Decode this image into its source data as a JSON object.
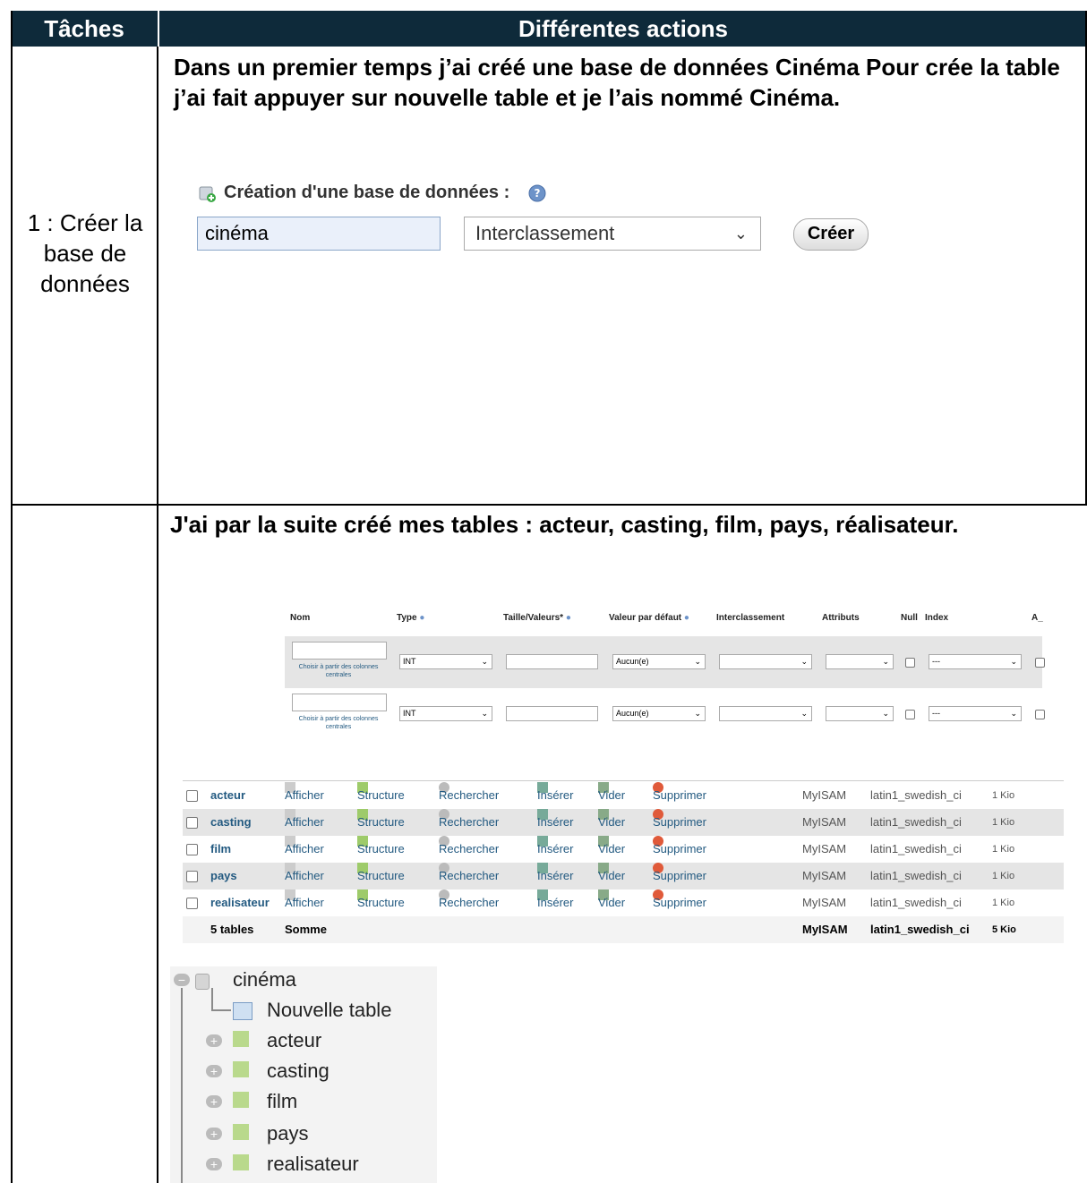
{
  "header": {
    "col1": "Tâches",
    "col2": "Différentes actions"
  },
  "task1": {
    "label": "1 : Créer la base de données",
    "text": "Dans un premier temps j’ai créé une base de données Cinéma Pour crée la table j’ai fait appuyer sur nouvelle table et je l’ais nommé Cinéma.",
    "widget": {
      "title": "Création d'une base de données :",
      "db_name_value": "cinéma",
      "collation_placeholder": "Interclassement",
      "create_button": "Créer"
    }
  },
  "task2": {
    "text": "J'ai par la suite créé mes tables : acteur, casting, film, pays, réalisateur.",
    "column_form": {
      "headers": [
        "Nom",
        "Type",
        "Taille/Valeurs*",
        "Valeur par défaut",
        "Interclassement",
        "Attributs",
        "Null",
        "Index",
        "A_"
      ],
      "rows": [
        {
          "type": "INT",
          "default": "Aucun(e)",
          "index": "---",
          "link": "Choisir à partir des colonnes centrales"
        },
        {
          "type": "INT",
          "default": "Aucun(e)",
          "index": "---",
          "link": "Choisir à partir des colonnes centrales"
        }
      ]
    },
    "tables": {
      "actions": [
        "Afficher",
        "Structure",
        "Rechercher",
        "Insérer",
        "Vider",
        "Supprimer"
      ],
      "rows": [
        {
          "name": "acteur",
          "engine": "MyISAM",
          "collation": "latin1_swedish_ci",
          "size": "1 Kio"
        },
        {
          "name": "casting",
          "engine": "MyISAM",
          "collation": "latin1_swedish_ci",
          "size": "1 Kio"
        },
        {
          "name": "film",
          "engine": "MyISAM",
          "collation": "latin1_swedish_ci",
          "size": "1 Kio"
        },
        {
          "name": "pays",
          "engine": "MyISAM",
          "collation": "latin1_swedish_ci",
          "size": "1 Kio"
        },
        {
          "name": "realisateur",
          "engine": "MyISAM",
          "collation": "latin1_swedish_ci",
          "size": "1 Kio"
        }
      ],
      "summary": {
        "count": "5 tables",
        "label": "Somme",
        "engine": "MyISAM",
        "collation": "latin1_swedish_ci",
        "size": "5 Kio"
      }
    },
    "tree": {
      "db": "cinéma",
      "new_table": "Nouvelle table",
      "items": [
        "acteur",
        "casting",
        "film",
        "pays",
        "realisateur"
      ]
    }
  },
  "colors": {
    "header_bg": "#0e2a3a",
    "link": "#235a81",
    "row_alt": "#e5e5e5"
  }
}
